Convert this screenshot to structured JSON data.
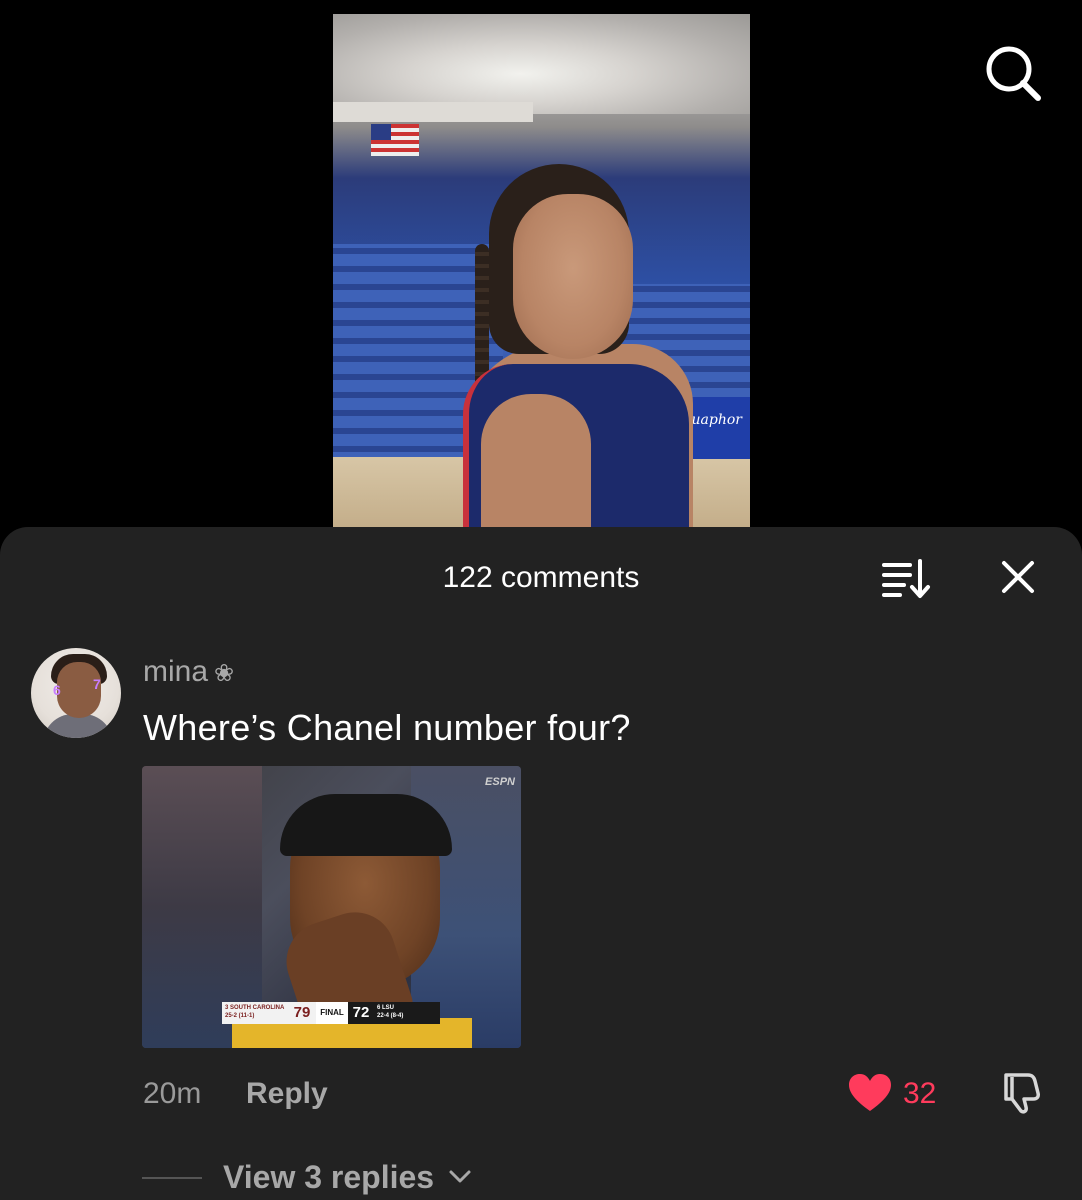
{
  "header": {
    "comments_title": "122 comments"
  },
  "video": {
    "sign_text": "Aquaphor"
  },
  "comment": {
    "username": "mina",
    "username_emblem": "❀",
    "avatar_stickers": [
      "6",
      "7"
    ],
    "text": "Where’s Chanel number four?",
    "attachment": {
      "watermark": "ESPN",
      "scorebug": {
        "team1_name": "3 SOUTH CAROLINA",
        "team1_record": "25-2 (11-1)",
        "team1_score": "79",
        "status": "FINAL",
        "team2_score": "72",
        "team2_name": "6 LSU",
        "team2_record": "22-4 (8-4)"
      }
    },
    "time": "20m",
    "reply_label": "Reply",
    "like_count": "32",
    "view_replies_label": "View 3 replies"
  },
  "icons": {
    "search": "search-icon",
    "sort": "sort-icon",
    "close": "close-icon",
    "like": "heart-icon",
    "dislike": "thumbs-down-icon",
    "chevron": "chevron-down-icon"
  },
  "colors": {
    "sheet_bg": "#222222",
    "like_accent": "#ff3b5c",
    "secondary_text": "#a8a8a8"
  }
}
